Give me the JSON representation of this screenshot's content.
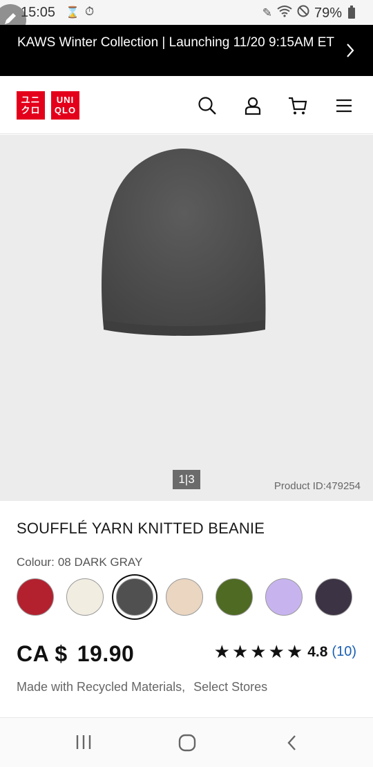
{
  "status_bar": {
    "time": "15:05",
    "battery": "79%",
    "icons": [
      "hourglass-icon",
      "timer-icon",
      "pen-icon",
      "wifi-icon",
      "do-not-disturb-icon",
      "battery-icon"
    ]
  },
  "announcement": {
    "text": "KAWS Winter Collection | Launching 11/20 9:15AM ET"
  },
  "header": {
    "logo_top": "ユニ クロ",
    "logo_right": "UNI QLO",
    "brand_color": "#e4001b",
    "icons": [
      "search-icon",
      "account-icon",
      "cart-icon",
      "menu-icon"
    ]
  },
  "gallery": {
    "pager": "1|3",
    "product_id": "Product ID:479254"
  },
  "product": {
    "title": "SOUFFLÉ YARN KNITTED BEANIE",
    "colour_label": "Colour:",
    "colour_value": "08 DARK GRAY",
    "swatches": [
      {
        "color": "#b3212f"
      },
      {
        "color": "#f1ede1"
      },
      {
        "color": "#505050",
        "selected": true
      },
      {
        "color": "#ead6c1"
      },
      {
        "color": "#4f6a23"
      },
      {
        "color": "#c7b4ef"
      },
      {
        "color": "#3c3344"
      }
    ],
    "currency": "CA $",
    "price": "19.90",
    "stars": "★★★★★",
    "rating": "4.8",
    "review_count": "(10)",
    "tag_1": "Made with Recycled Materials,",
    "tag_2": "Select Stores"
  },
  "nav_bar": {
    "icons": [
      "recent-apps-icon",
      "home-icon",
      "back-icon"
    ]
  }
}
